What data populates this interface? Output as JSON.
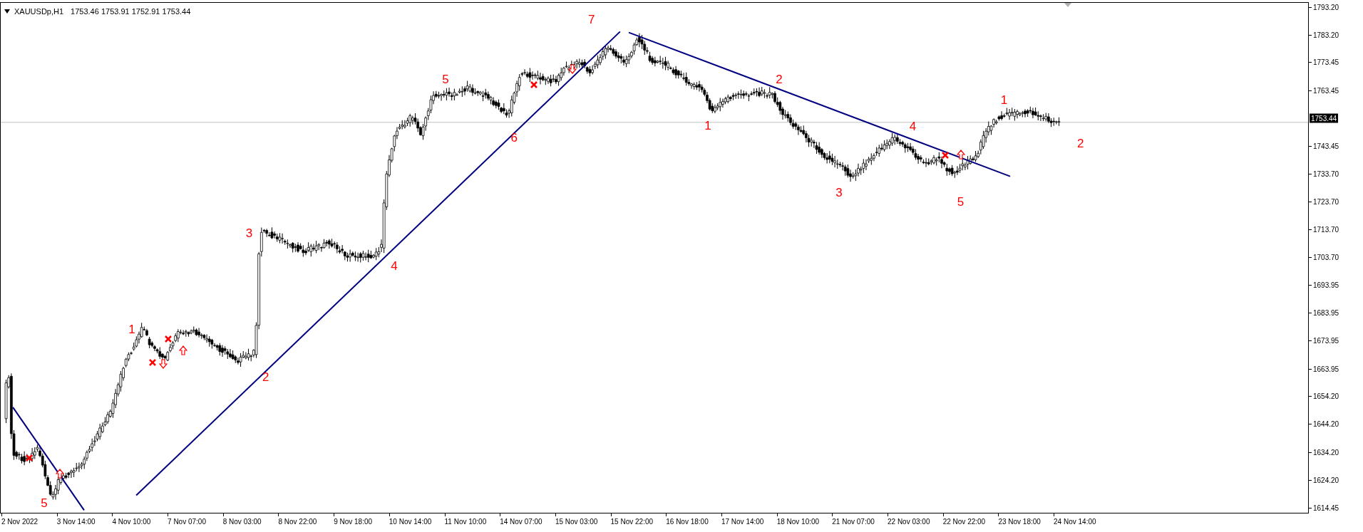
{
  "chart": {
    "symbol": "XAUUSDp,H1",
    "ohlc": [
      "1753.46",
      "1753.91",
      "1752.91",
      "1753.44"
    ]
  },
  "price_axis": {
    "labels": [
      "1793.20",
      "1783.20",
      "1773.45",
      "1763.45",
      "1743.45",
      "1733.70",
      "1723.70",
      "1713.70",
      "1703.70",
      "1693.95",
      "1683.95",
      "1673.95",
      "1663.95",
      "1654.20",
      "1644.20",
      "1634.20",
      "1624.20",
      "1614.45"
    ],
    "current_price": "1753.44"
  },
  "time_axis": {
    "labels": [
      "2 Nov 2022",
      "3 Nov 14:00",
      "4 Nov 10:00",
      "7 Nov 07:00",
      "8 Nov 03:00",
      "8 Nov 22:00",
      "9 Nov 18:00",
      "10 Nov 14:00",
      "11 Nov 10:00",
      "14 Nov 07:00",
      "15 Nov 03:00",
      "15 Nov 22:00",
      "16 Nov 18:00",
      "17 Nov 14:00",
      "18 Nov 10:00",
      "21 Nov 07:00",
      "22 Nov 03:00",
      "22 Nov 22:00",
      "23 Nov 18:00",
      "24 Nov 14:00"
    ]
  },
  "wave_labels": [
    "5",
    "1",
    "3",
    "2",
    "4",
    "5",
    "6",
    "7",
    "1",
    "2",
    "3",
    "4",
    "5",
    "1",
    "2"
  ]
}
